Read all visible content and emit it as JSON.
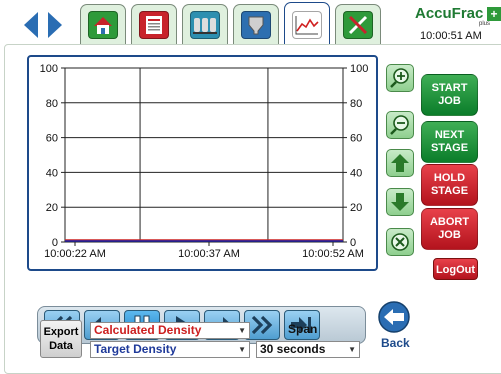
{
  "header": {
    "logo": "AccuFrac",
    "logo_sub": "plus",
    "time": "10:00:51 AM",
    "tabs": [
      {
        "name": "home-icon",
        "color": "#2e9a3a"
      },
      {
        "name": "report-icon",
        "color": "#c8232b"
      },
      {
        "name": "tanks-icon",
        "color": "#2d8fb0"
      },
      {
        "name": "hopper-icon",
        "color": "#2d6fb0"
      },
      {
        "name": "chart-icon",
        "color": "#ffffff"
      },
      {
        "name": "tools-icon",
        "color": "#2e9a3a"
      }
    ]
  },
  "side": {
    "start": [
      "START",
      "JOB"
    ],
    "next": [
      "NEXT",
      "STAGE"
    ],
    "hold": [
      "HOLD",
      "STAGE"
    ],
    "abort": [
      "ABORT",
      "JOB"
    ],
    "logout": "LogOut"
  },
  "chart_data": {
    "type": "line",
    "x_ticks": [
      "10:00:22 AM",
      "10:00:37 AM",
      "10:00:52 AM"
    ],
    "y_ticks": [
      0,
      20,
      40,
      60,
      80,
      100
    ],
    "ylim": [
      0,
      100
    ],
    "grid": true,
    "series": [
      {
        "color": "#cc2222",
        "values": [
          0,
          0
        ]
      },
      {
        "color": "#2222aa",
        "values": [
          0,
          0
        ]
      }
    ]
  },
  "bottom": {
    "export": [
      "Export",
      "Data"
    ],
    "series1": "Calculated Density",
    "series2": "Target Density",
    "span_label": "Span",
    "span_value": "30 seconds",
    "back": "Back"
  },
  "colors": {
    "accent_blue": "#1d4a8a",
    "series1_text": "#cc1f1f",
    "series2_text": "#1f3a9a"
  }
}
